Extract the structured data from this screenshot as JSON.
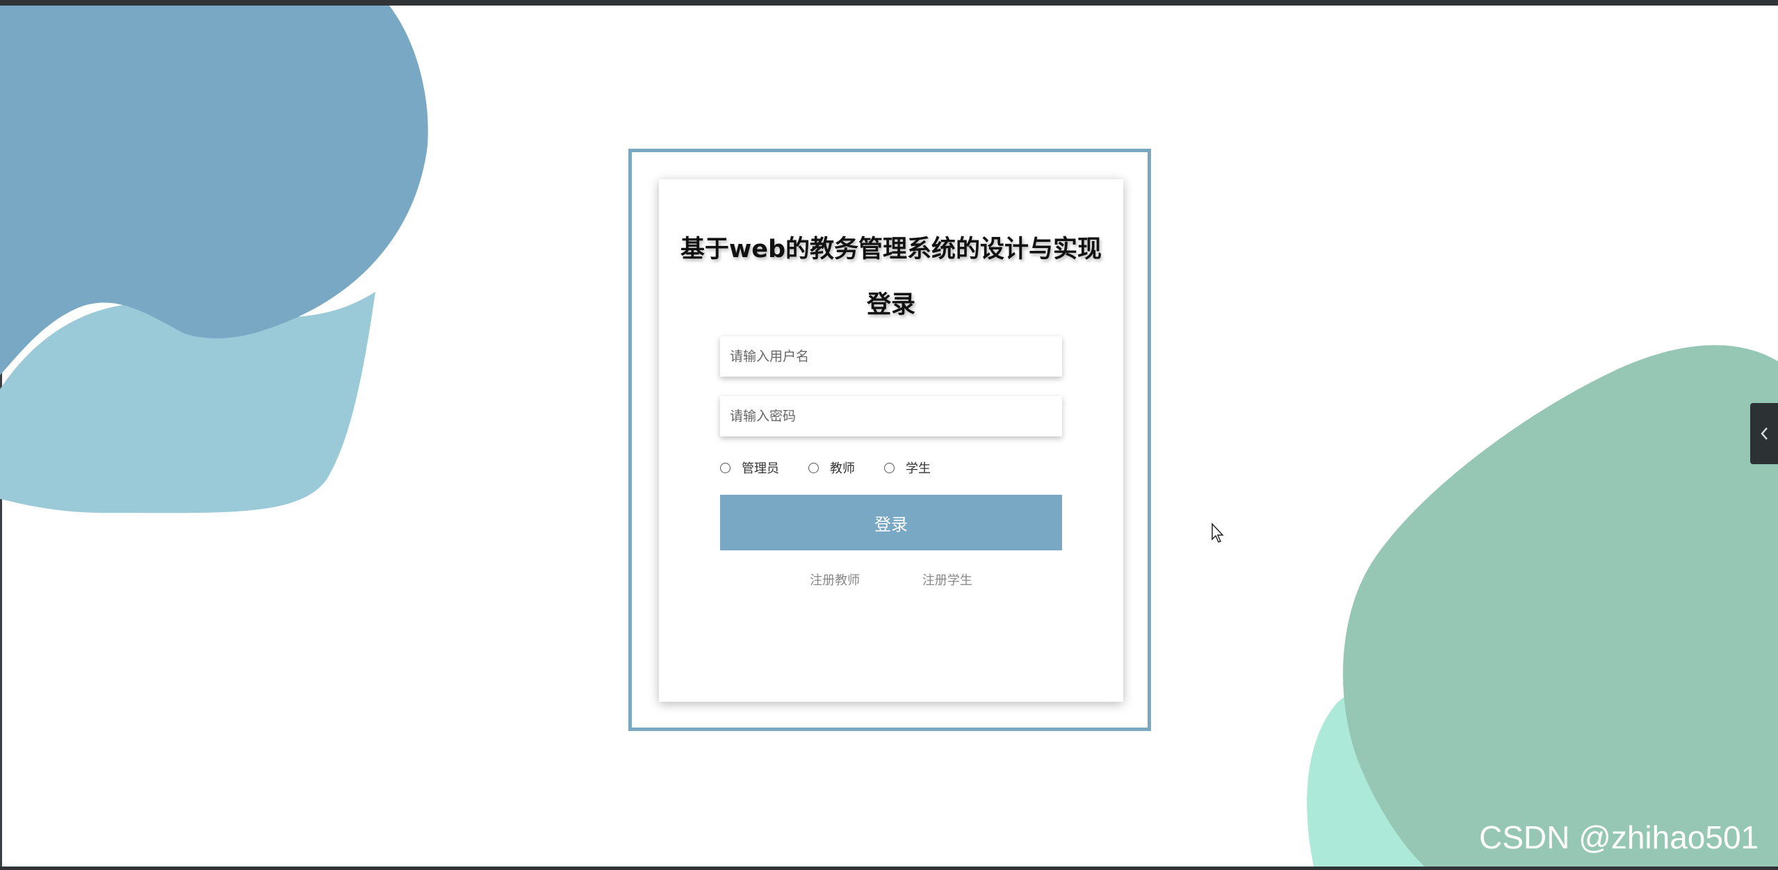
{
  "title": "基于web的教务管理系统的设计与实现",
  "subtitle": "登录",
  "form": {
    "username_placeholder": "请输入用户名",
    "password_placeholder": "请输入密码",
    "roles": [
      "管理员",
      "教师",
      "学生"
    ],
    "login_label": "登录"
  },
  "links": {
    "register_teacher": "注册教师",
    "register_student": "注册学生"
  },
  "side_tab": {
    "icon": "chevron-left-icon"
  },
  "watermark": "CSDN @zhihao501",
  "colors": {
    "accent": "#78a8c3",
    "frame": "#7ba8c1",
    "blob_blue_dark": "#78a8c3",
    "blob_blue_light": "#9ac9d8",
    "blob_green": "#95c7b4",
    "blob_mint": "#ade9d8"
  }
}
